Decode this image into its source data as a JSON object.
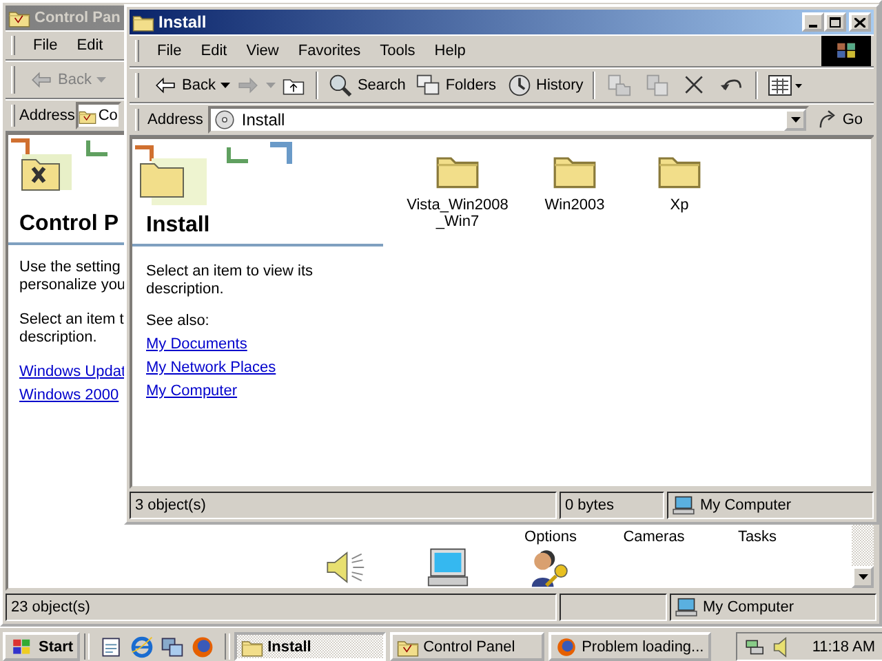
{
  "control_panel_window": {
    "title": "Control Pan",
    "menu": [
      "File",
      "Edit"
    ],
    "toolbar": [
      {
        "kind": "back",
        "label": "Back",
        "disabled": true
      }
    ],
    "address": {
      "label": "Address",
      "value": "Co"
    },
    "pane": {
      "title": "Control P",
      "paragraphs": [
        [
          "Use the setting",
          "personalize you"
        ],
        [
          "Select an item t",
          "description."
        ]
      ],
      "links": [
        "Windows Updat",
        "Windows 2000"
      ]
    },
    "item_labels": [
      "Options",
      "Cameras",
      "Tasks"
    ],
    "items": [
      {
        "kind": "speaker"
      },
      {
        "kind": "monitor"
      },
      {
        "kind": "users"
      }
    ],
    "status_bar": [
      "23 object(s)",
      "My Computer"
    ]
  },
  "install_window": {
    "title": "Install",
    "menu": [
      "File",
      "Edit",
      "View",
      "Favorites",
      "Tools",
      "Help"
    ],
    "toolbar": [
      {
        "kind": "back",
        "label": "Back",
        "disabled": false
      },
      {
        "kind": "forward",
        "disabled": true
      },
      {
        "kind": "up",
        "disabled": false
      },
      {
        "kind": "search",
        "label": "Search",
        "disabled": false
      },
      {
        "kind": "folders",
        "label": "Folders",
        "disabled": false
      },
      {
        "kind": "history",
        "label": "History",
        "disabled": false
      },
      {
        "kind": "move",
        "disabled": true
      },
      {
        "kind": "copy",
        "disabled": true
      },
      {
        "kind": "delete",
        "disabled": false
      },
      {
        "kind": "undo",
        "disabled": false
      },
      {
        "kind": "views",
        "disabled": false
      }
    ],
    "address": {
      "label": "Address",
      "value": "Install",
      "go": "Go"
    },
    "pane": {
      "title": "Install",
      "description": "Select an item to view its description.",
      "see_also": "See also:",
      "links": [
        "My Documents",
        "My Network Places",
        "My Computer"
      ]
    },
    "folders": [
      {
        "name": "Vista_Win2008 _Win7",
        "selected": false
      },
      {
        "name": "Win2003",
        "selected": false
      },
      {
        "name": "Xp",
        "selected": false
      }
    ],
    "status_bar": [
      "3 object(s)",
      "0 bytes",
      "My Computer"
    ]
  },
  "taskbar": {
    "start": "Start",
    "quick_launch": [
      {
        "kind": "desktop"
      },
      {
        "kind": "browser"
      },
      {
        "kind": "channels"
      },
      {
        "kind": "firefox"
      }
    ],
    "tasks": [
      {
        "kind": "folder",
        "label": "Install",
        "selected": true
      },
      {
        "kind": "control",
        "label": "Control Panel",
        "selected": false
      },
      {
        "kind": "firefox",
        "label": "Problem loading...",
        "selected": false
      }
    ],
    "clock": "11:18 AM"
  }
}
